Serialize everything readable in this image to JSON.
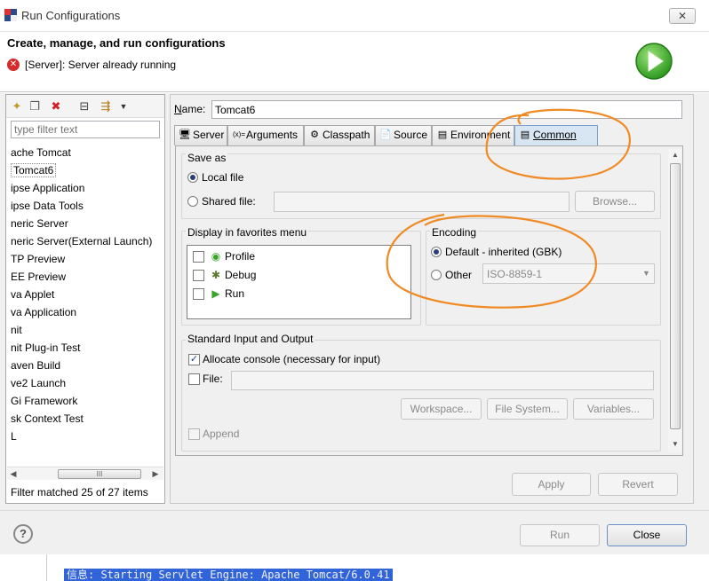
{
  "window": {
    "title": "Run Configurations",
    "close_label": "✕"
  },
  "header": {
    "title": "Create, manage, and run configurations",
    "error_message": "[Server]: Server already running"
  },
  "filter": {
    "placeholder": "type filter text"
  },
  "tree": {
    "items": [
      "ache Tomcat",
      "Tomcat6",
      "ipse Application",
      "ipse Data Tools",
      "neric Server",
      "neric Server(External Launch)",
      "TP Preview",
      "EE Preview",
      "va Applet",
      "va Application",
      "nit",
      "nit Plug-in Test",
      "aven Build",
      "ve2 Launch",
      "Gi Framework",
      "sk Context Test",
      "L"
    ],
    "selected_index": 1,
    "filter_status": "Filter matched 25 of 27 items",
    "scroll_thumb_glyph": "III"
  },
  "config": {
    "name_label": "Name:",
    "name_value": "Tomcat6",
    "tabs": [
      {
        "label": "Server",
        "icon": "server-icon",
        "glyph": "🖥"
      },
      {
        "label": "Arguments",
        "icon": "arguments-icon",
        "glyph": "(x)="
      },
      {
        "label": "Classpath",
        "icon": "classpath-icon",
        "glyph": "⚙"
      },
      {
        "label": "Source",
        "icon": "source-icon",
        "glyph": "📄"
      },
      {
        "label": "Environment",
        "icon": "environment-icon",
        "glyph": "▤"
      },
      {
        "label": "Common",
        "icon": "common-icon",
        "glyph": "▤"
      }
    ],
    "active_tab": "Common",
    "save_as": {
      "title": "Save as",
      "local_file_label": "Local file",
      "shared_file_label": "Shared file:",
      "browse_label": "Browse..."
    },
    "favorites": {
      "title": "Display in favorites menu",
      "items": [
        "Profile",
        "Debug",
        "Run"
      ]
    },
    "encoding": {
      "title": "Encoding",
      "default_label": "Default - inherited (GBK)",
      "other_label": "Other",
      "other_value": "ISO-8859-1"
    },
    "stdio": {
      "title": "Standard Input and Output",
      "allocate_label": "Allocate console (necessary for input)",
      "file_label": "File:",
      "workspace_label": "Workspace...",
      "filesystem_label": "File System...",
      "variables_label": "Variables...",
      "append_label": "Append"
    },
    "apply_label": "Apply",
    "revert_label": "Revert"
  },
  "footer": {
    "run_label": "Run",
    "close_label": "Close",
    "help_label": "?"
  },
  "console": {
    "text": "信息: Starting Servlet Engine: Apache Tomcat/6.0.41"
  },
  "colors": {
    "annotation": "#f08a24",
    "console_highlight": "#3064d8",
    "accent_green": "#3aa52b"
  }
}
